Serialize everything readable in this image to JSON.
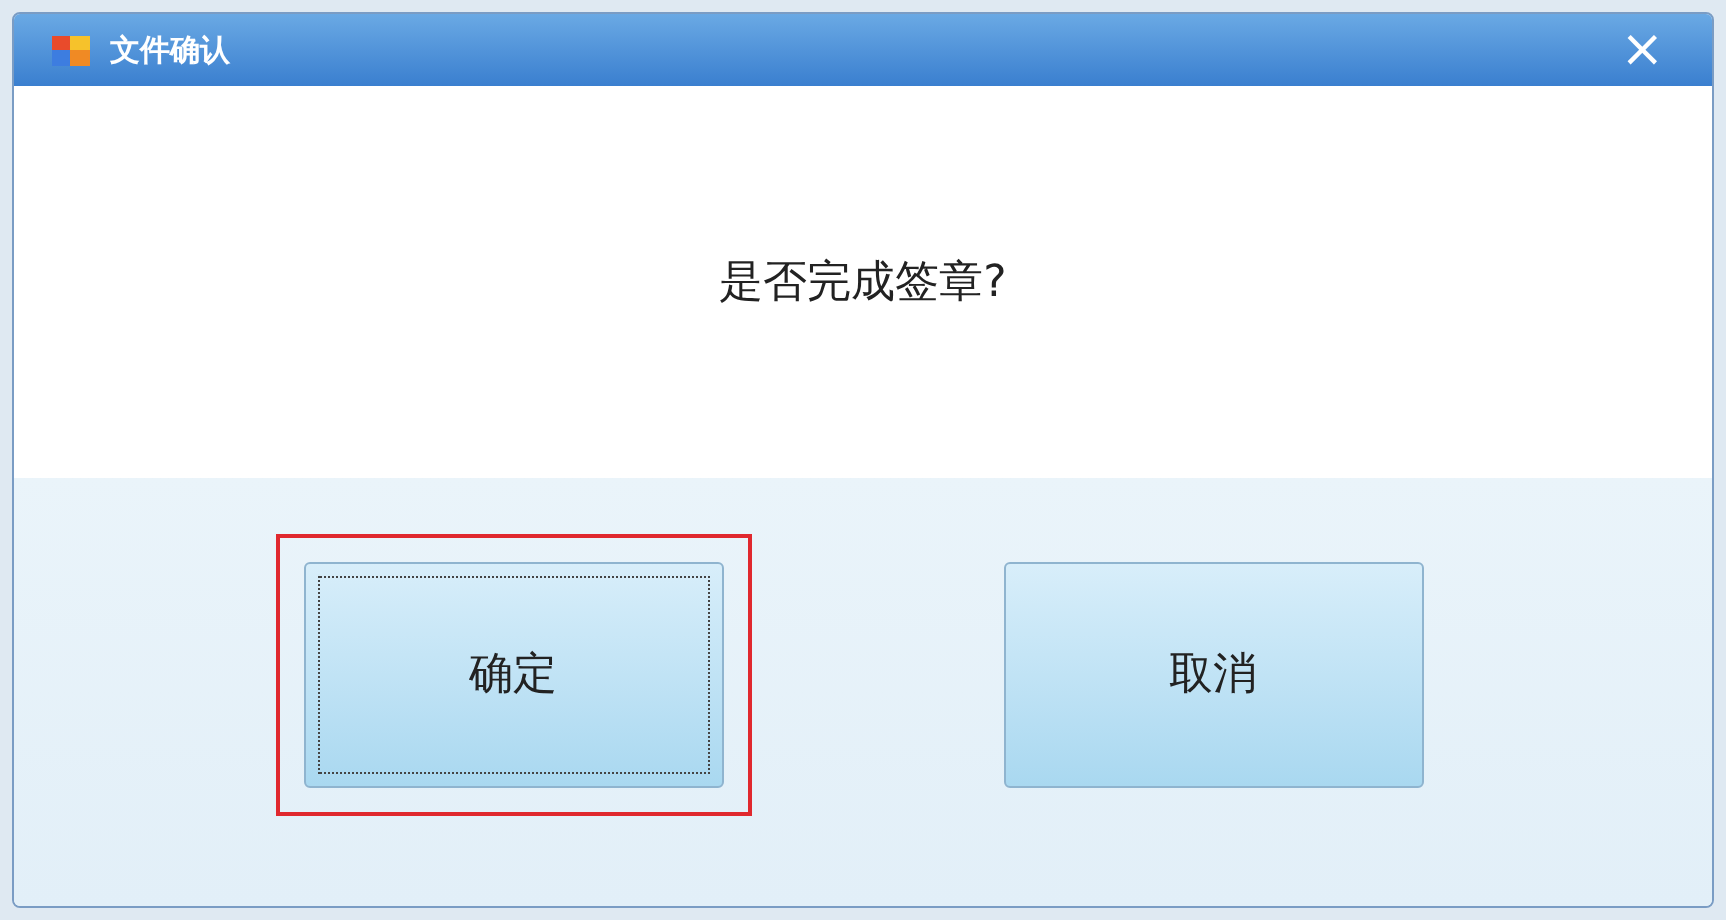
{
  "window": {
    "title": "文件确认",
    "close": "×"
  },
  "message": "是否完成签章?",
  "buttons": [
    {
      "label": "确定",
      "focused": true,
      "highlighted": true
    },
    {
      "label": "取消",
      "focused": false,
      "highlighted": false
    }
  ]
}
